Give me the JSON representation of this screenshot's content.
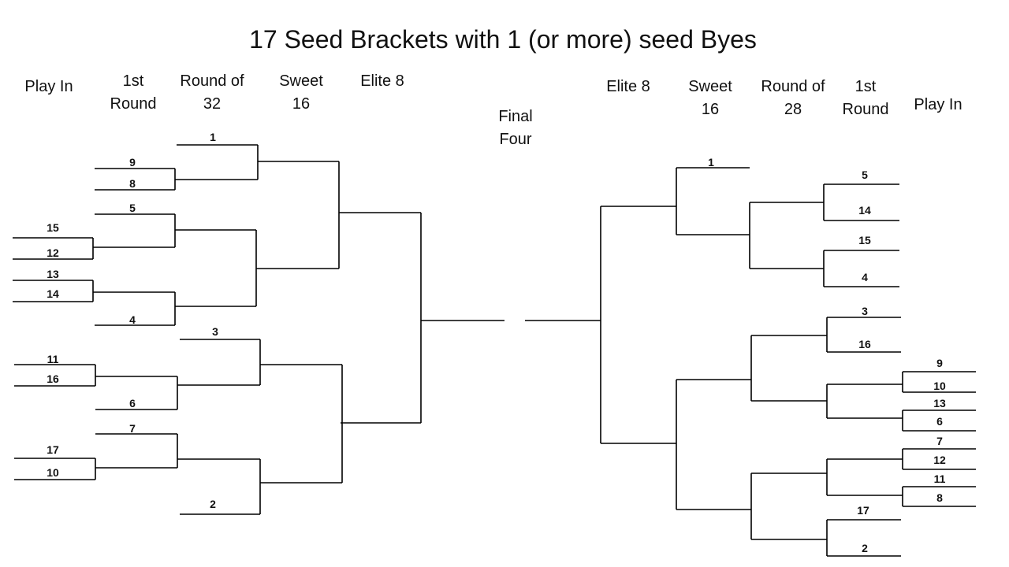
{
  "title": "17 Seed Brackets with 1 (or more) seed Byes",
  "final_four": [
    "Final",
    "Four"
  ],
  "left_headers": {
    "play_in": "Play In",
    "first_round": [
      "1st",
      "Round"
    ],
    "round_of": [
      "Round of",
      "32"
    ],
    "sweet": [
      "Sweet",
      "16"
    ],
    "elite": "Elite 8"
  },
  "right_headers": {
    "elite": "Elite 8",
    "sweet": [
      "Sweet",
      "16"
    ],
    "round_of": [
      "Round of",
      "28"
    ],
    "first_round": [
      "1st",
      "Round"
    ],
    "play_in": "Play In"
  },
  "left_seeds": {
    "r32_top": "1",
    "r1_a": "9",
    "r1_b": "8",
    "r1_c": "5",
    "pi_a": "15",
    "pi_b": "12",
    "pi_c": "13",
    "pi_d": "14",
    "r1_d": "4",
    "r32_mid": "3",
    "pi_e": "11",
    "pi_f": "16",
    "r1_e": "6",
    "r1_f": "7",
    "pi_g": "17",
    "pi_h": "10",
    "r32_bot": "2"
  },
  "right_seeds": {
    "s16_top": "1",
    "r1_a": "5",
    "r1_b": "14",
    "r1_c": "15",
    "r1_d": "4",
    "r1_e": "3",
    "r1_f": "16",
    "pi_a": "9",
    "pi_b": "10",
    "pi_c": "13",
    "pi_d": "6",
    "pi_e": "7",
    "pi_f": "12",
    "pi_g": "11",
    "pi_h": "8",
    "r1_g": "17",
    "r1_h": "2"
  }
}
